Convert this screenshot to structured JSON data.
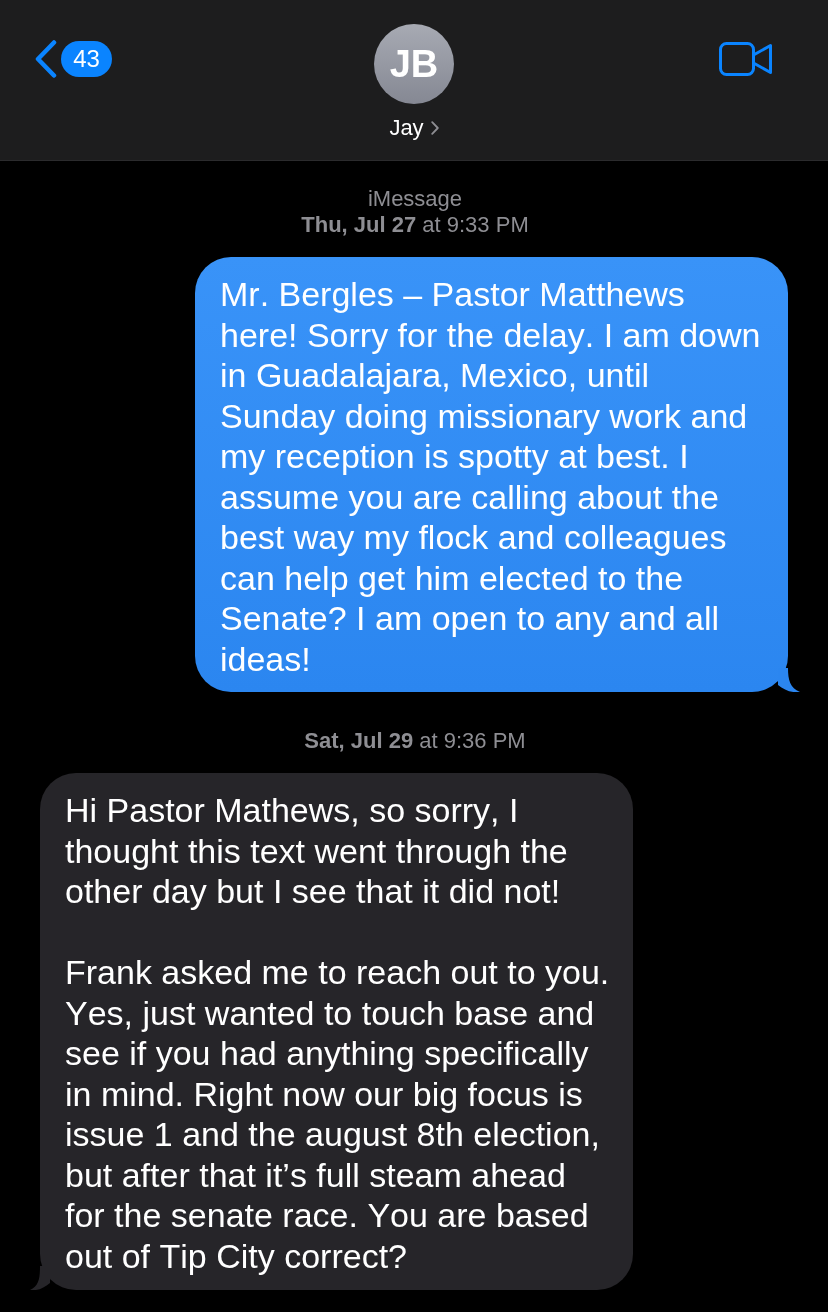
{
  "navigation_bar": {
    "back_count": "43",
    "avatar_initials": "JB",
    "contact_name": "Jay"
  },
  "conversation": [
    {
      "kind": "service",
      "text": "iMessage"
    },
    {
      "kind": "timestamp",
      "text": "**Thu, Jul 27** at 9:33 PM"
    },
    {
      "kind": "sent",
      "paragraphs": [
        "Mr. Bergles – Pastor Matthews here! Sorry for the delay. I am down in Guadalajara, Mexico, until Sunday doing missionary work and my reception is spotty at best. I assume you are calling about the best way my flock and colleagues can help get him elected to the Senate? I am open to any and all ideas!"
      ]
    },
    {
      "kind": "timestamp",
      "text": "**Sat, Jul 29** at 9:36 PM"
    },
    {
      "kind": "received",
      "paragraphs": [
        "Hi Pastor Mathews, so sorry, I thought this text went through the other day but I see that it did not!",
        "Frank asked me to reach out to you. Yes, just wanted to touch base and see if you had anything specifically in mind. Right now our big focus is issue 1 and the august 8th election, but after that it’s full steam ahead for the senate race. You are based out of Tip City correct?"
      ]
    }
  ]
}
